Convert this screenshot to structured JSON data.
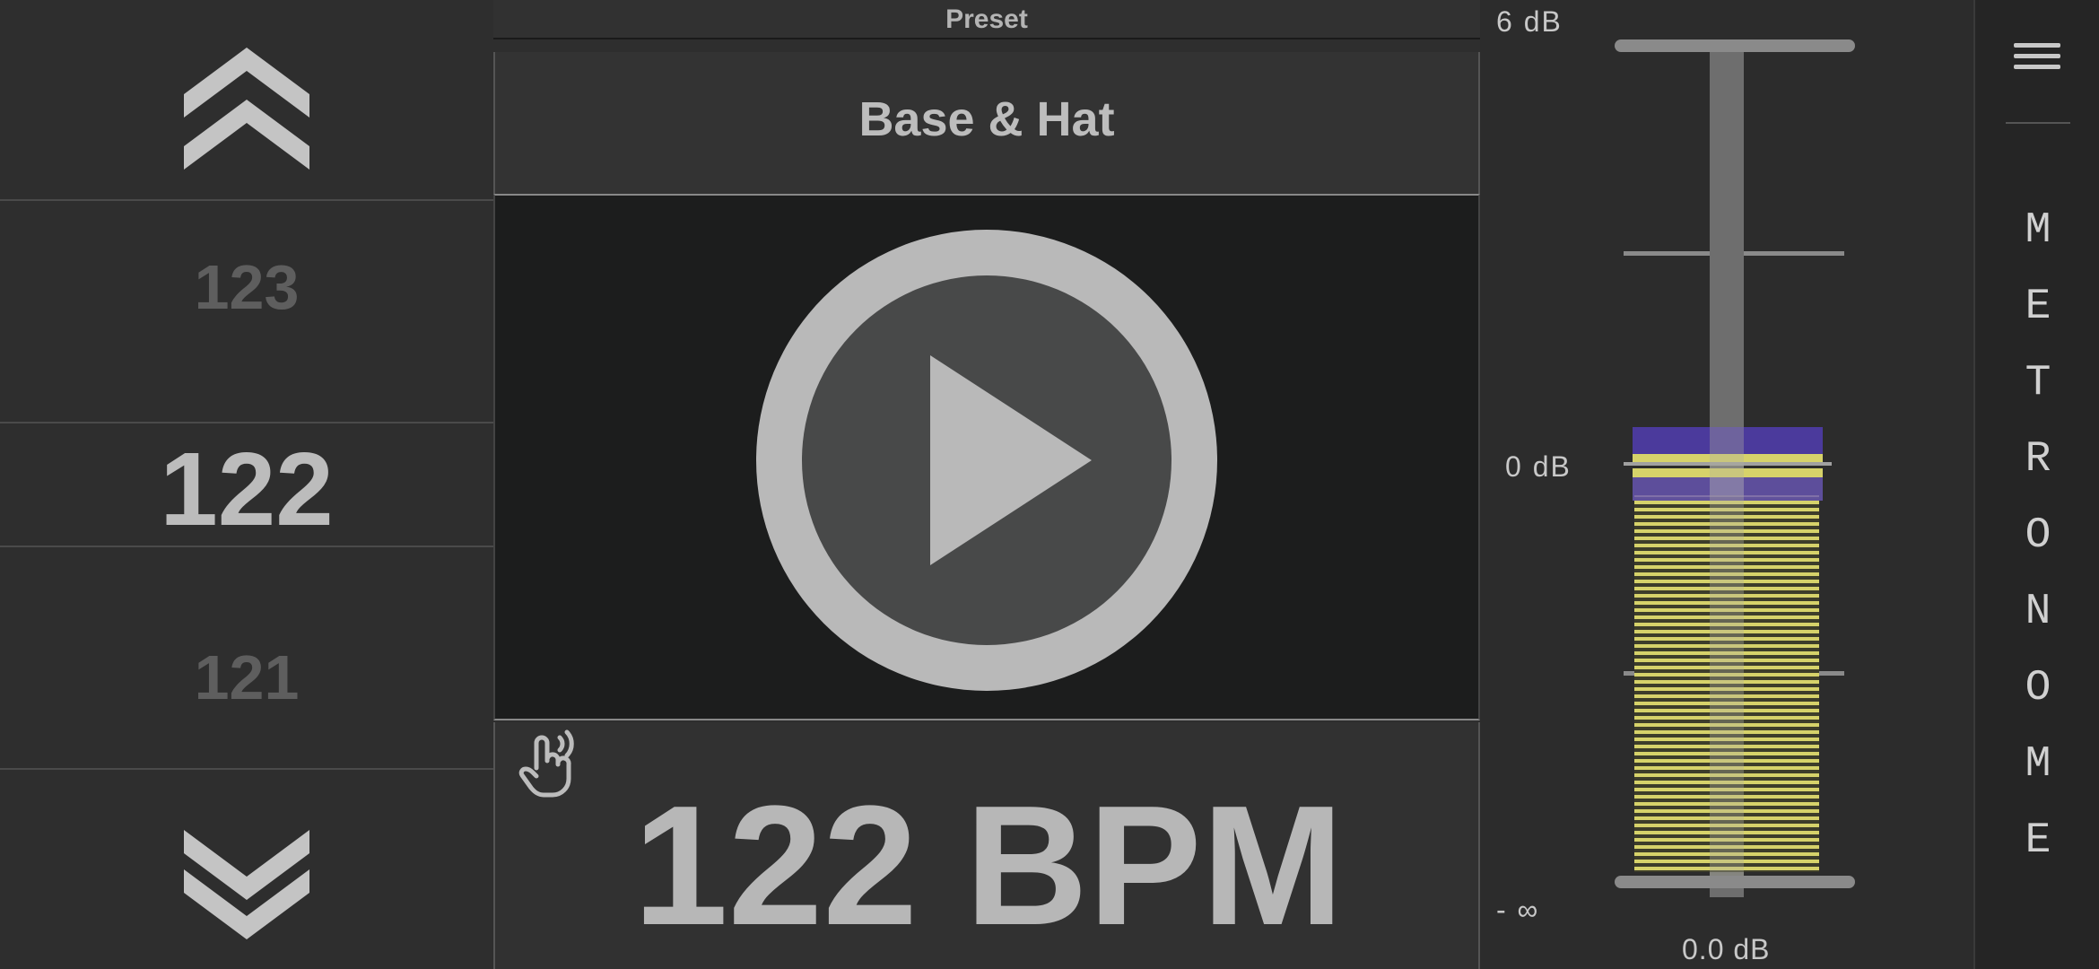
{
  "picker": {
    "up_icon": "double-chevron-up-icon",
    "down_icon": "double-chevron-down-icon",
    "above": "123",
    "current": "122",
    "below": "121"
  },
  "preset": {
    "label": "Preset",
    "name": "Base & Hat"
  },
  "transport": {
    "play_icon": "play-icon",
    "tap_icon": "tap-tempo-icon",
    "bpm_text": "122 BPM"
  },
  "volume": {
    "max_label": "6 dB",
    "zero_label": "0 dB",
    "min_label": "- ∞",
    "value_label": "0.0 dB",
    "level_fraction": 0.49,
    "colors": {
      "meter_fill": "#d6d26a",
      "peak_fill": "#4b3a9c",
      "track": "#7a7a7a"
    }
  },
  "sidebar": {
    "menu_icon": "hamburger-menu-icon",
    "title_letters": [
      "M",
      "E",
      "T",
      "R",
      "O",
      "N",
      "O",
      "M",
      "E"
    ]
  }
}
